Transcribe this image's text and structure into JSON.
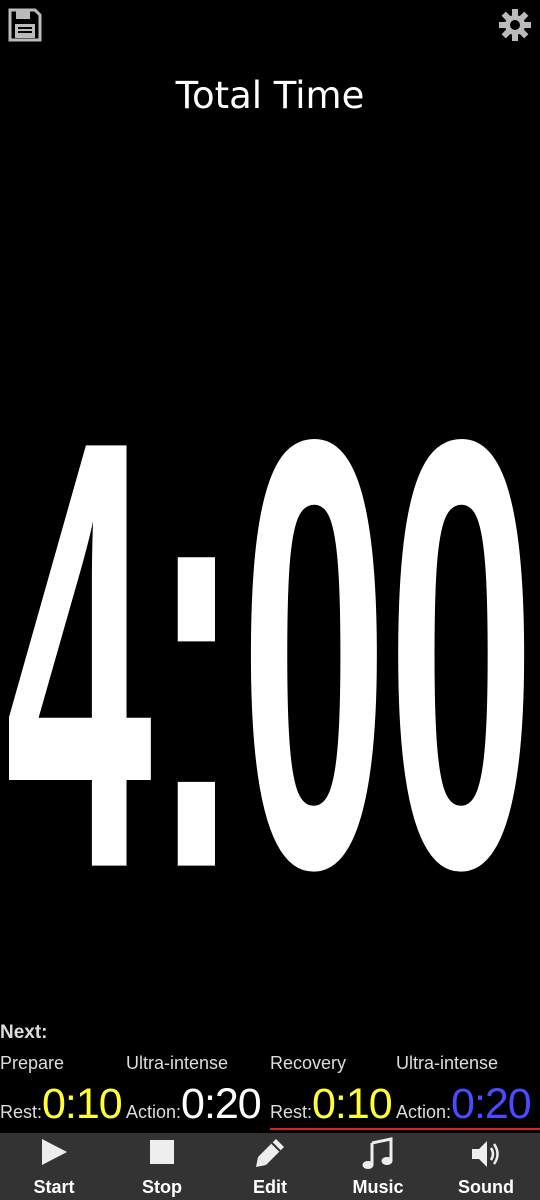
{
  "header": {
    "save_icon": "save-icon",
    "settings_icon": "gear-icon",
    "title": "Total Time"
  },
  "timer": {
    "display": "4:00"
  },
  "next": {
    "label": "Next:",
    "segments": [
      {
        "name": "Prepare",
        "type_label": "Rest:",
        "time": "0:10",
        "color": "#ffff33"
      },
      {
        "name": "Ultra-intense",
        "type_label": "Action:",
        "time": "0:20",
        "color": "#ffffff"
      },
      {
        "name": "Recovery",
        "type_label": "Rest:",
        "time": "0:10",
        "color": "#ffff33"
      },
      {
        "name": "Ultra-intense",
        "type_label": "Action:",
        "time": "0:20",
        "color": "#4a4aff"
      }
    ]
  },
  "toolbar": {
    "start_label": "Start",
    "stop_label": "Stop",
    "edit_label": "Edit",
    "music_label": "Music",
    "sound_label": "Sound"
  },
  "colors": {
    "background": "#000000",
    "toolbar_bg": "#333333",
    "rest_time": "#ffff33",
    "action_time": "#ffffff",
    "action_time_alt": "#4a4aff",
    "current_underline": "#e02020"
  }
}
